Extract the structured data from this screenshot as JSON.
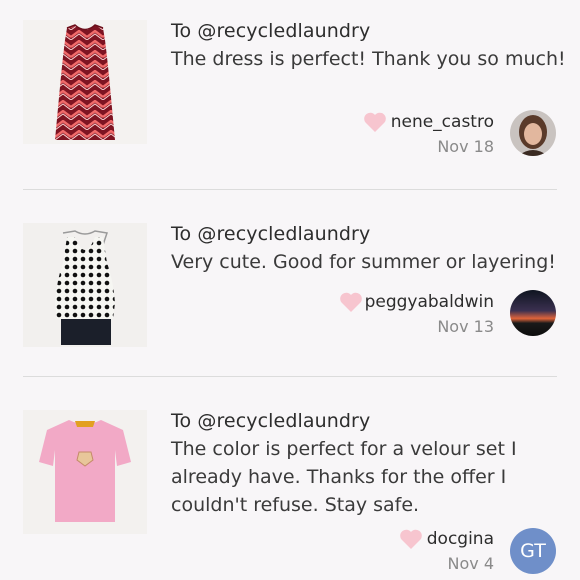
{
  "feed": {
    "items": [
      {
        "recipient": "To @recycledlaundry",
        "message": "The dress is perfect! Thank you so much!",
        "username": "nene_castro",
        "date": "Nov 18",
        "product_icon": "zigzag-dress",
        "avatar_icon": "profile-photo"
      },
      {
        "recipient": "To @recycledlaundry",
        "message": "Very cute. Good for summer or layering!",
        "username": "peggyabaldwin",
        "date": "Nov 13",
        "product_icon": "polka-dot-top",
        "avatar_icon": "sunset-photo"
      },
      {
        "recipient": "To @recycledlaundry",
        "message": "The color is perfect for a velour set I already have. Thanks for the offer I couldn't refuse. Stay safe.",
        "username": "docgina",
        "date": "Nov 4",
        "product_icon": "pink-tshirt",
        "avatar_initials": "GT"
      }
    ]
  },
  "colors": {
    "heart": "#f7c5cf",
    "avatar_initials_bg": "#6f8fc9",
    "divider": "#dcdcdc",
    "date_text": "#8a8a8a"
  }
}
